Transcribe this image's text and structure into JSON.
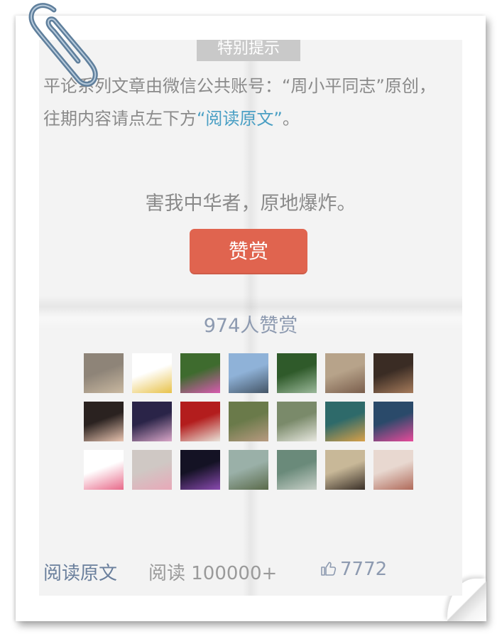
{
  "notice_tag": "特别提示",
  "intro": {
    "text_before": "平论系列文章由微信公共账号：“周小平同志”原创，往期内容请点左下方",
    "link_text": "“阅读原文”",
    "text_after": "。"
  },
  "slogan": "害我中华者，原地爆炸。",
  "reward_button": "赞赏",
  "reward_count": "974人赞赏",
  "avatars": [
    {
      "name": "avatar-teddy-bear",
      "colors": [
        "#8e8478",
        "#c9b8a0"
      ]
    },
    {
      "name": "avatar-small-sticker",
      "colors": [
        "#ffffff",
        "#e8c24a"
      ]
    },
    {
      "name": "avatar-orchids",
      "colors": [
        "#3e6b2e",
        "#d85ab0"
      ]
    },
    {
      "name": "avatar-person-on-shore",
      "colors": [
        "#8fb2d8",
        "#445566"
      ]
    },
    {
      "name": "avatar-forest",
      "colors": [
        "#2f5a2a",
        "#9bb89a"
      ]
    },
    {
      "name": "avatar-plaid",
      "colors": [
        "#b7a38a",
        "#7a5e4c"
      ]
    },
    {
      "name": "avatar-dark-interior",
      "colors": [
        "#3a2c24",
        "#a67b5b"
      ]
    },
    {
      "name": "avatar-smiling-girl",
      "colors": [
        "#2a2220",
        "#e9c4b0"
      ]
    },
    {
      "name": "avatar-heart-mountains",
      "colors": [
        "#2a2448",
        "#d9a6c8"
      ]
    },
    {
      "name": "avatar-strawberries",
      "colors": [
        "#b31d1d",
        "#e8e2d8"
      ]
    },
    {
      "name": "avatar-couple",
      "colors": [
        "#6a7a4a",
        "#b89a80"
      ]
    },
    {
      "name": "avatar-white-horse",
      "colors": [
        "#7a8a6a",
        "#e8e8e0"
      ]
    },
    {
      "name": "avatar-painted-figure",
      "colors": [
        "#2e6a6a",
        "#d8a048"
      ]
    },
    {
      "name": "avatar-rainbow-hair",
      "colors": [
        "#2a4a6a",
        "#e84a9a"
      ]
    },
    {
      "name": "avatar-lotus",
      "colors": [
        "#ffffff",
        "#e86a8a"
      ]
    },
    {
      "name": "avatar-toddler",
      "colors": [
        "#cfc8c4",
        "#e8a8b8"
      ]
    },
    {
      "name": "avatar-night-lights",
      "colors": [
        "#141224",
        "#8a4ab0"
      ]
    },
    {
      "name": "avatar-boat-river",
      "colors": [
        "#9ab0a8",
        "#5a6a4a"
      ]
    },
    {
      "name": "avatar-waterfall",
      "colors": [
        "#6a8a7a",
        "#c8d0c8"
      ]
    },
    {
      "name": "avatar-calligraphy",
      "colors": [
        "#c8b898",
        "#3a3028"
      ]
    },
    {
      "name": "avatar-illustration",
      "colors": [
        "#e8d8d0",
        "#b06a5a"
      ]
    }
  ],
  "footer": {
    "read_original": "阅读原文",
    "read_count": "阅读 100000+",
    "like_count": "7772"
  },
  "colors": {
    "link": "#4a9fc4",
    "reward_button": "#e0644f",
    "muted_text": "#8a8a8a",
    "blue_gray": "#8d9ab0"
  }
}
